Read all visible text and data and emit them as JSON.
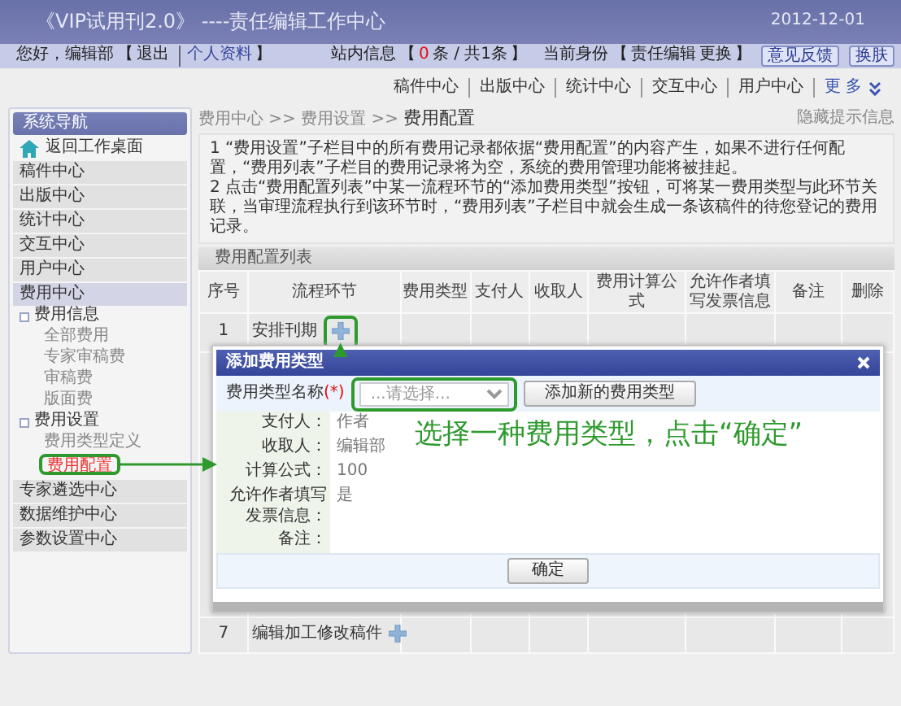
{
  "header": {
    "title": "《VIP试用刊2.0》 ----责任编辑工作中心",
    "date": "2012-12-01"
  },
  "user_bar": {
    "account": {
      "greeting": "您好，编辑部",
      "open": "【",
      "links": [
        "退出",
        "个人资料"
      ],
      "close": "】"
    },
    "messages": {
      "label": "站内信息",
      "open": "【",
      "unread": "0",
      "text": "条 / 共1条",
      "close": "】"
    },
    "identity": {
      "label": "当前身份",
      "open": "【",
      "role": "责任编辑",
      "link": "更换",
      "close": "】"
    },
    "buttons": [
      "意见反馈",
      "换肤"
    ]
  },
  "top_nav": {
    "items": [
      "稿件中心",
      "出版中心",
      "统计中心",
      "交互中心",
      "用户中心"
    ],
    "more": "更 多"
  },
  "sidebar": {
    "title": "系统导航",
    "items": [
      {
        "label": "返回工作桌面",
        "kind": "home",
        "selected": false
      },
      {
        "label": "稿件中心",
        "kind": "section",
        "selected": false
      },
      {
        "label": "出版中心",
        "kind": "section",
        "selected": false
      },
      {
        "label": "统计中心",
        "kind": "section",
        "selected": false
      },
      {
        "label": "交互中心",
        "kind": "section",
        "selected": false
      },
      {
        "label": "用户中心",
        "kind": "section",
        "selected": false
      },
      {
        "label": "费用中心",
        "kind": "section",
        "selected": true,
        "children": [
          {
            "label": "费用信息",
            "kind": "group",
            "expanded": true,
            "children": [
              {
                "label": "全部费用",
                "selected": false,
                "highlighted": false
              },
              {
                "label": "专家审稿费",
                "selected": false,
                "highlighted": false
              },
              {
                "label": "审稿费",
                "selected": false,
                "highlighted": false
              },
              {
                "label": "版面费",
                "selected": false,
                "highlighted": false
              }
            ]
          },
          {
            "label": "费用设置",
            "kind": "group",
            "expanded": true,
            "children": [
              {
                "label": "费用类型定义",
                "selected": false,
                "highlighted": false
              },
              {
                "label": "费用配置",
                "selected": true,
                "highlighted": true
              }
            ]
          }
        ]
      },
      {
        "label": "专家遴选中心",
        "kind": "section",
        "selected": false
      },
      {
        "label": "数据维护中心",
        "kind": "section",
        "selected": false
      },
      {
        "label": "参数设置中心",
        "kind": "section",
        "selected": false
      }
    ]
  },
  "breadcrumb": {
    "path": "费用中心 >> 费用设置 >>",
    "current": "费用配置"
  },
  "hide_tips_link": "隐藏提示信息",
  "tips": [
    "1 “费用设置”子栏目中的所有费用记录都依据“费用配置”的内容产生，如果不进行任何配置，“费用列表”子栏目的费用记录将为空，系统的费用管理功能将被挂起。",
    "2 点击“费用配置列表”中某一流程环节的“添加费用类型”按钮，可将某一费用类型与此环节关联，当审理流程执行到该环节时，“费用列表”子栏目中就会生成一条该稿件的待您登记的费用记录。"
  ],
  "table": {
    "title": "费用配置列表",
    "columns": [
      "序号",
      "流程环节",
      "费用类型",
      "支付人",
      "收取人",
      "费用计算公式",
      "允许作者填写发票信息",
      "备注",
      "删除"
    ],
    "rows": [
      {
        "index": "1",
        "stage": "安排刊期",
        "add_highlighted": true
      },
      {
        "index": "7",
        "stage": "编辑加工修改稿件",
        "add_highlighted": false
      }
    ]
  },
  "dialog": {
    "title": "添加费用类型",
    "type_label": "费用类型名称",
    "required_mark": "(*)",
    "placeholder": "...请选择...",
    "select_highlighted": true,
    "add_button": "添加新的费用类型",
    "fields": [
      {
        "label": "支付人：",
        "value": "作者"
      },
      {
        "label": "收取人：",
        "value": "编辑部"
      },
      {
        "label": "计算公式：",
        "value": "100"
      },
      {
        "label": "允许作者填写发票信息：",
        "value": "是"
      },
      {
        "label": "备注："
      }
    ],
    "confirm_button": "确定"
  },
  "annotation": {
    "text": "选择一种费用类型，点击“确定”"
  }
}
